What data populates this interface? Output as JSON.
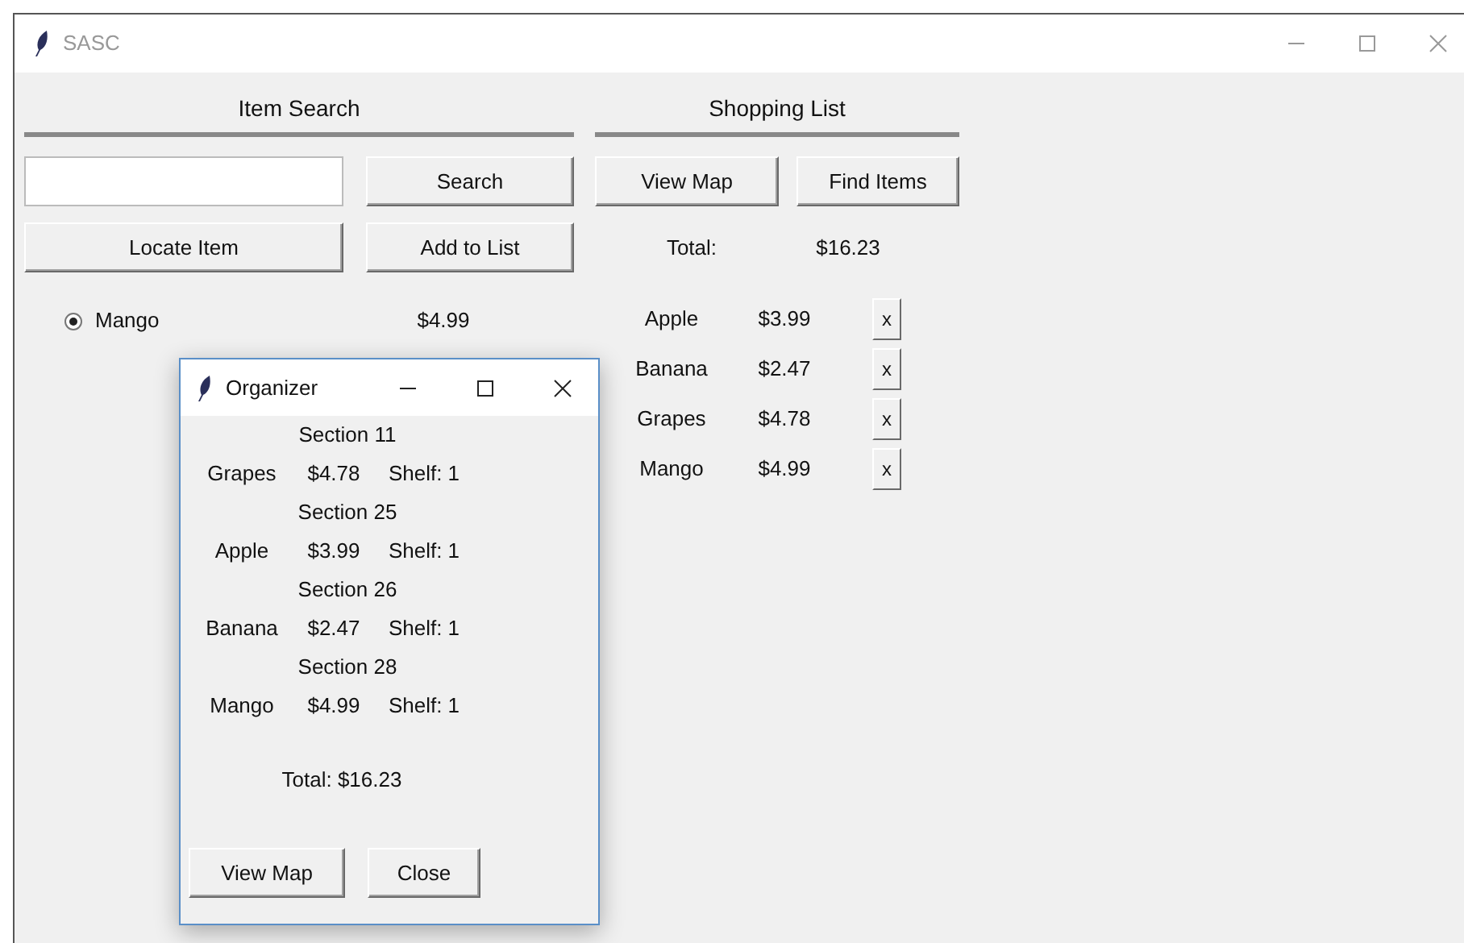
{
  "window": {
    "title": "SASC"
  },
  "item_search": {
    "heading": "Item Search",
    "search_button": "Search",
    "locate_button": "Locate Item",
    "add_button": "Add to List",
    "results": [
      {
        "name": "Mango",
        "price": "$4.99",
        "selected": true
      }
    ]
  },
  "shopping_list": {
    "heading": "Shopping List",
    "buttons": [
      "View Map",
      "Find Items"
    ],
    "total_label": "Total:",
    "total": "$16.23",
    "items": [
      {
        "name": "Apple",
        "price": "$3.99",
        "remove": "x"
      },
      {
        "name": "Banana",
        "price": "$2.47",
        "remove": "x"
      },
      {
        "name": "Grapes",
        "price": "$4.78",
        "remove": "x"
      },
      {
        "name": "Mango",
        "price": "$4.99",
        "remove": "x"
      }
    ]
  },
  "organizer": {
    "title": "Organizer",
    "sections": [
      {
        "section": "Section 11",
        "name": "Grapes",
        "price": "$4.78",
        "shelf": "Shelf: 1"
      },
      {
        "section": "Section 25",
        "name": "Apple",
        "price": "$3.99",
        "shelf": "Shelf: 1"
      },
      {
        "section": "Section 26",
        "name": "Banana",
        "price": "$2.47",
        "shelf": "Shelf: 1"
      },
      {
        "section": "Section 28",
        "name": "Mango",
        "price": "$4.99",
        "shelf": "Shelf: 1"
      }
    ],
    "total": "Total: $16.23",
    "buttons": [
      "View Map",
      "Close"
    ]
  }
}
